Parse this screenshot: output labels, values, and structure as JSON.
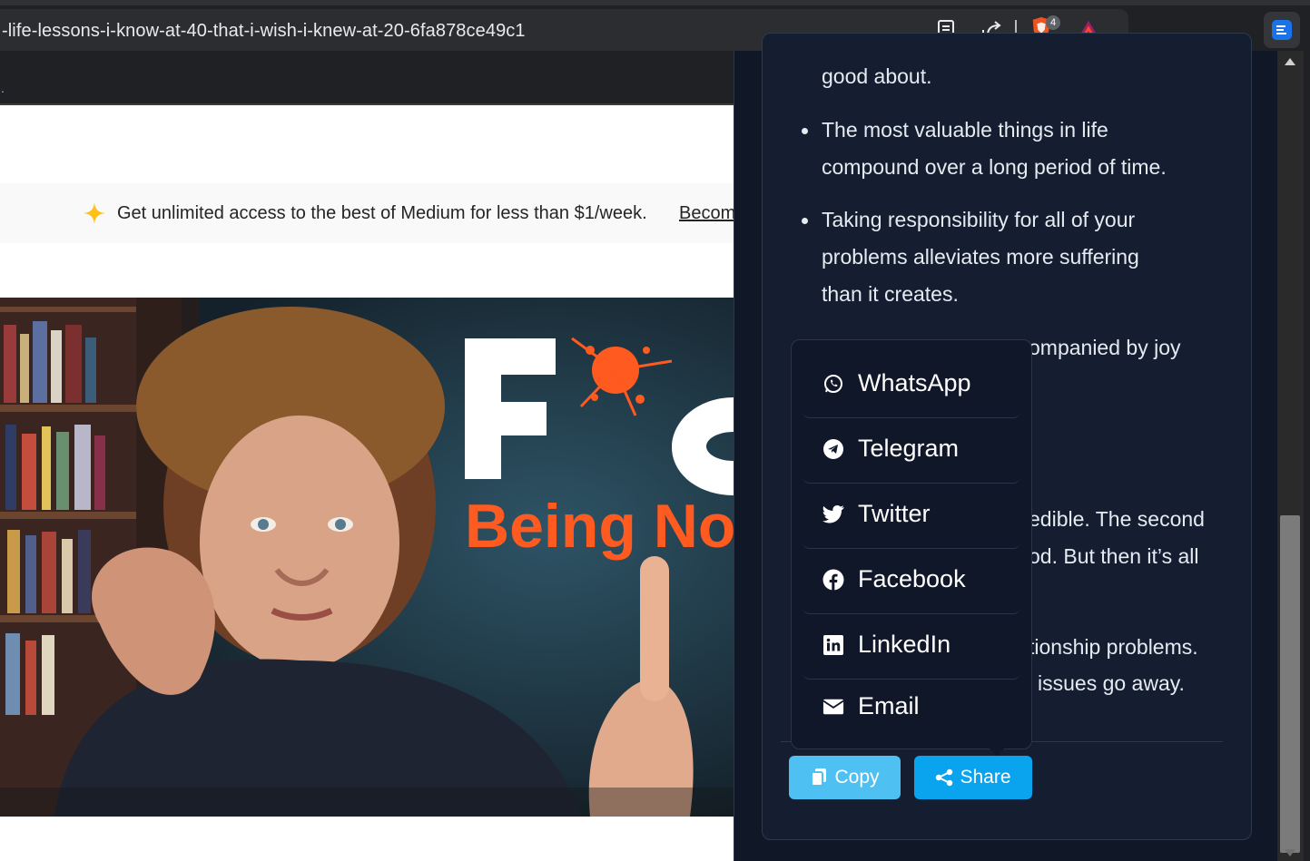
{
  "browser": {
    "url": "-life-lessons-i-know-at-40-that-i-wish-i-knew-at-20-6fa878ce49c1",
    "brave_badge": "4",
    "bookmark_dot": "."
  },
  "banner": {
    "text": "Get unlimited access to the best of Medium for less than $1/week.",
    "link": "Becom"
  },
  "hero": {
    "title_letter": "F",
    "title_partial": "O",
    "subtitle": "Being No"
  },
  "panel": {
    "lines": [
      "good about.",
      "The most valuable things in life",
      "compound over a long period of time.",
      "Taking responsibility for all of your",
      "problems alleviates more suffering",
      "than it creates.",
      "ompanied by joy",
      "edible. The second",
      "od. But then it’s all",
      "tionship problems.",
      "issues go away."
    ]
  },
  "share_menu": {
    "items": [
      {
        "label": "WhatsApp",
        "icon": "whatsapp-icon"
      },
      {
        "label": "Telegram",
        "icon": "telegram-icon"
      },
      {
        "label": "Twitter",
        "icon": "twitter-icon"
      },
      {
        "label": "Facebook",
        "icon": "facebook-icon"
      },
      {
        "label": "LinkedIn",
        "icon": "linkedin-icon"
      },
      {
        "label": "Email",
        "icon": "email-icon"
      }
    ]
  },
  "actions": {
    "copy": "Copy",
    "share": "Share"
  },
  "colors": {
    "panel_bg": "#101828",
    "copy_button": "#4ec0f2",
    "share_button": "#0aa3ed",
    "hero_orange": "#ff5a1f"
  }
}
